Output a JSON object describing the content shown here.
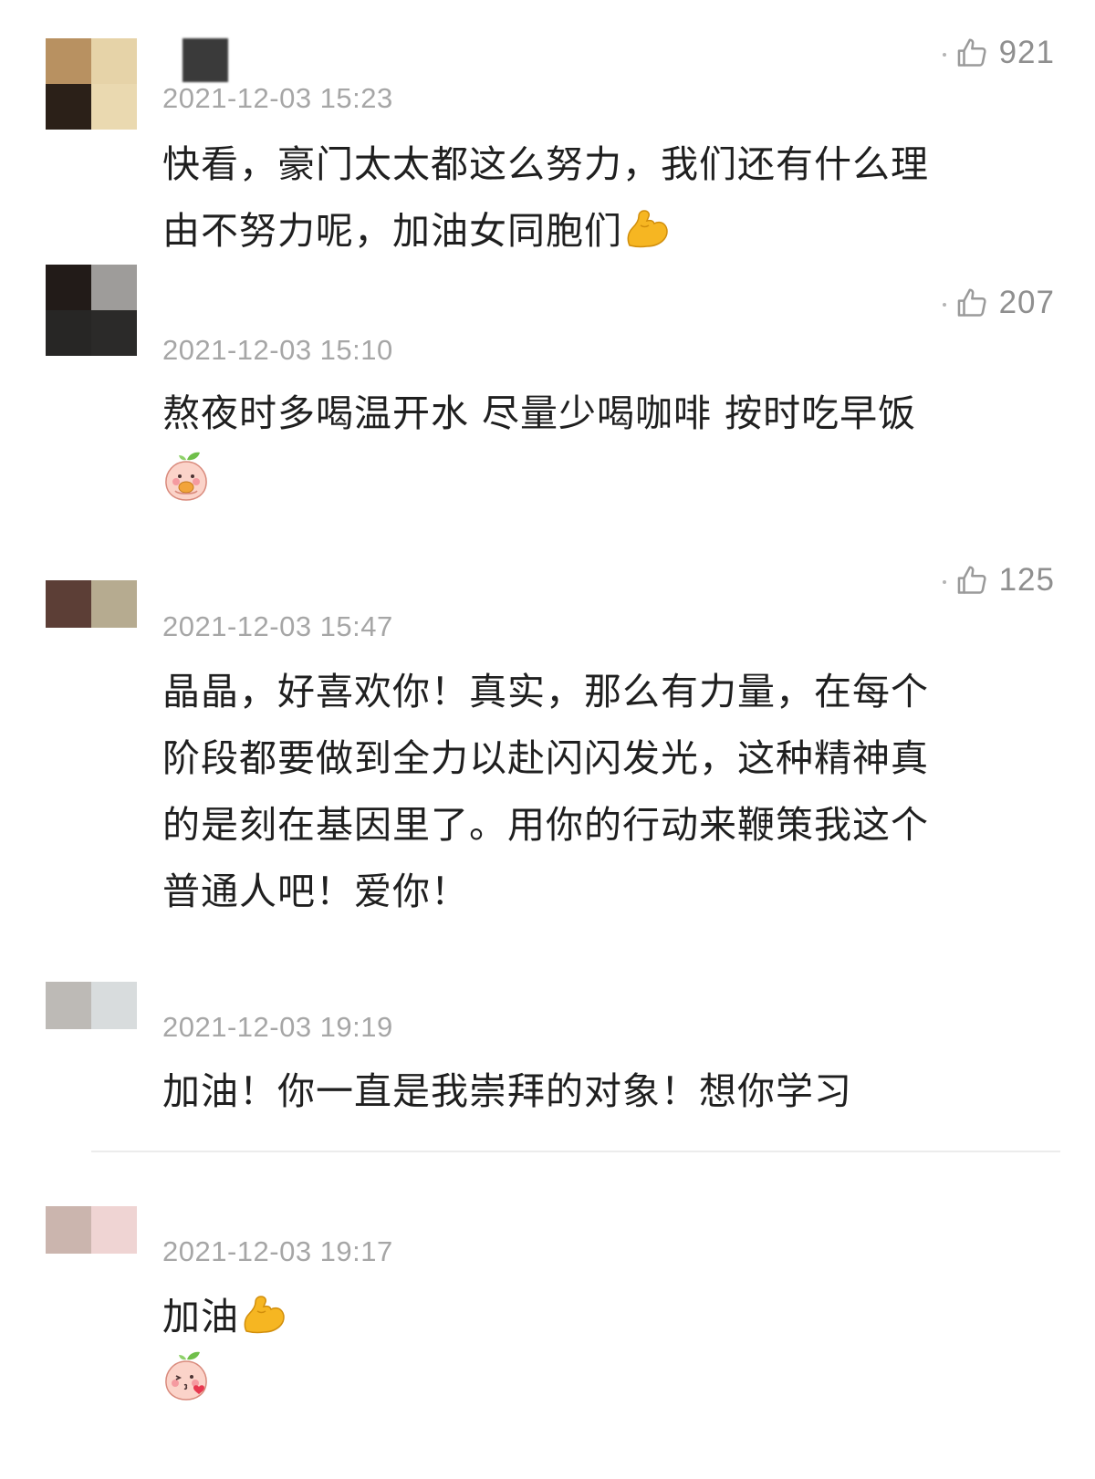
{
  "colors": {
    "timestamp": "#a6a6a6",
    "like": "#8f8f8f",
    "text": "#1f1f1f",
    "divider": "#ececec"
  },
  "comments": [
    {
      "timestamp": "2021-12-03 15:23",
      "likes": "921",
      "lines": [
        "快看，豪门太太都这么努力，我们还有什么理",
        "由不努力呢，加油女同胞们"
      ],
      "trailing_emoji": "flexed-biceps",
      "avatar_colors": [
        "#b89161",
        "#e6d3a8",
        "#2b2018",
        "#ead9b0"
      ]
    },
    {
      "timestamp": "2021-12-03 15:10",
      "likes": "207",
      "lines": [
        "熬夜时多喝温开水 尽量少喝咖啡 按时吃早饭"
      ],
      "sticker": "peach-sticker-eating",
      "avatar_colors": [
        "#221b18",
        "#9e9c9a",
        "#272625",
        "#2b2a29"
      ]
    },
    {
      "timestamp": "2021-12-03 15:47",
      "likes": "125",
      "lines": [
        "晶晶，好喜欢你！真实，那么有力量，在每个",
        "阶段都要做到全力以赴闪闪发光，这种精神真",
        "的是刻在基因里了。用你的行动来鞭策我这个",
        "普通人吧！爱你！"
      ],
      "avatar_colors": [
        "#5c3e36",
        "#b6ab90"
      ]
    },
    {
      "timestamp": "2021-12-03 19:19",
      "lines": [
        "加油！你一直是我崇拜的对象！想你学习"
      ],
      "avatar_colors": [
        "#bdbab6",
        "#d8dcdd"
      ]
    },
    {
      "timestamp": "2021-12-03 19:17",
      "lines": [
        "加油"
      ],
      "trailing_emoji": "flexed-biceps",
      "sticker": "peach-sticker-kiss",
      "avatar_colors": [
        "#cbb5ae",
        "#efd4d3"
      ]
    }
  ]
}
